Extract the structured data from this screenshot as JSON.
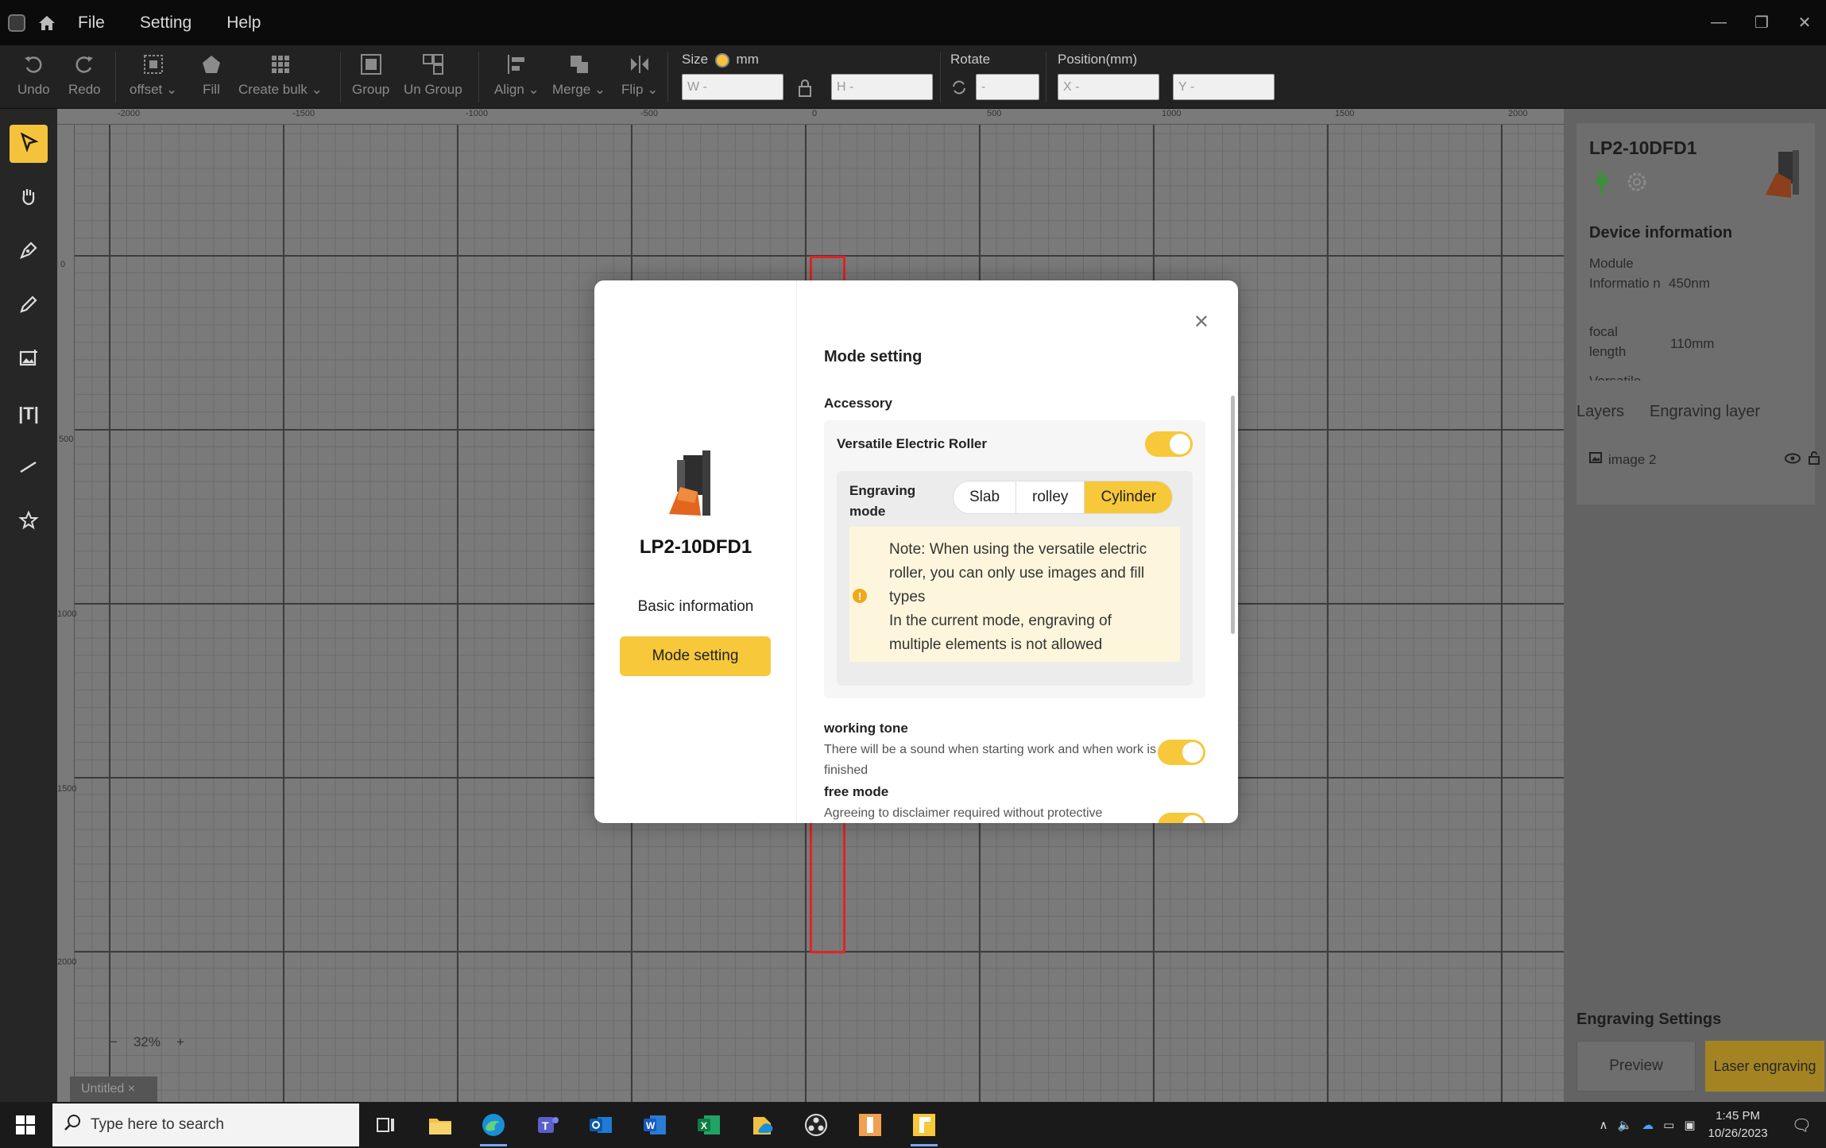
{
  "menu": {
    "file": "File",
    "setting": "Setting",
    "help": "Help"
  },
  "toolbar": {
    "undo": "Undo",
    "redo": "Redo",
    "offset": "offset",
    "fill": "Fill",
    "create_bulk": "Create bulk",
    "group": "Group",
    "ungroup": "Un Group",
    "align": "Align",
    "merge": "Merge",
    "flip": "Flip",
    "size_label": "Size",
    "unit": "mm",
    "w_placeholder": "W -",
    "h_placeholder": "H -",
    "rotate_label": "Rotate",
    "rotate_placeholder": "-",
    "position_label": "Position(mm)",
    "x_placeholder": "X -",
    "y_placeholder": "Y -"
  },
  "ruler": {
    "top": [
      "-2000",
      "-1500",
      "-1000",
      "-500",
      "0",
      "500",
      "1000",
      "1500",
      "2000"
    ],
    "left": [
      "0",
      "500",
      "1000",
      "1500",
      "2000"
    ]
  },
  "canvas": {
    "zoom": "32%",
    "tab": "Untitled"
  },
  "right_panel": {
    "device_name": "LP2-10DFD1",
    "device_info_title": "Device information",
    "module_label": "Module Informatio n",
    "module_value": "450nm",
    "focal_label": "focal length",
    "focal_value": "110mm",
    "versatile_label": "Versatile",
    "tabs": {
      "layers": "Layers",
      "engraving_layer": "Engraving layer"
    },
    "layer_item": "image 2",
    "engraving_settings": "Engraving Settings",
    "preview": "Preview",
    "laser_engraving": "Laser engraving"
  },
  "modal": {
    "device_name": "LP2-10DFD1",
    "basic_info": "Basic information",
    "mode_setting_btn": "Mode setting",
    "heading": "Mode setting",
    "accessory": "Accessory",
    "roller_label": "Versatile Electric Roller",
    "engraving_mode_label": "Engraving mode",
    "modes": [
      "Slab",
      "rolley",
      "Cylinder"
    ],
    "selected_mode": "Cylinder",
    "note_line1": "Note: When using the versatile electric roller, you can only use images and fill types",
    "note_line2": "In the current mode, engraving of multiple elements is not allowed",
    "working_tone": "working tone",
    "working_tone_desc": "There will be a sound when starting work and when work is finished",
    "free_mode": "free mode",
    "free_mode_desc": "Agreeing to disclaimer required without protective"
  },
  "taskbar": {
    "search_placeholder": "Type here to search",
    "time": "1:45 PM",
    "date": "10/26/2023"
  },
  "colors": {
    "accent": "#f6c83a",
    "selection_red": "#e02424"
  }
}
